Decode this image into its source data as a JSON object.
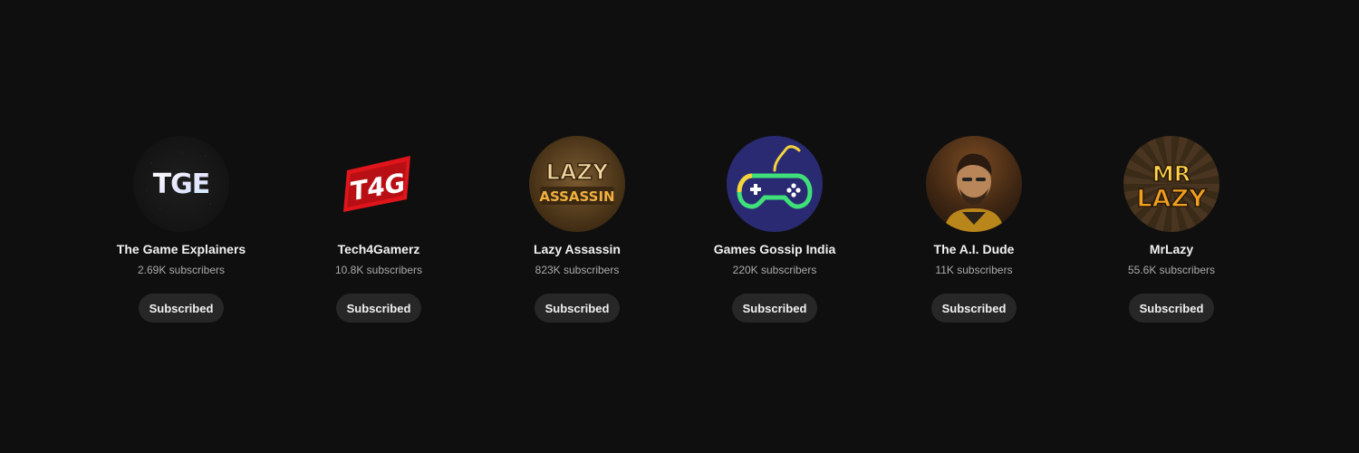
{
  "channels": [
    {
      "name": "The Game Explainers",
      "subscribers": "2.69K subscribers",
      "button": "Subscribed",
      "logo_text": "TGE",
      "icon": "tge-logo-icon"
    },
    {
      "name": "Tech4Gamerz",
      "subscribers": "10.8K subscribers",
      "button": "Subscribed",
      "logo_text": "T4G",
      "icon": "t4g-logo-icon"
    },
    {
      "name": "Lazy Assassin",
      "subscribers": "823K subscribers",
      "button": "Subscribed",
      "logo_text_top": "LAZY",
      "logo_text_bottom": "ASSASSIN",
      "icon": "lazy-assassin-logo-icon"
    },
    {
      "name": "Games Gossip India",
      "subscribers": "220K subscribers",
      "button": "Subscribed",
      "icon": "gamepad-icon"
    },
    {
      "name": "The A.I. Dude",
      "subscribers": "11K subscribers",
      "button": "Subscribed",
      "icon": "person-photo-icon"
    },
    {
      "name": "MrLazy",
      "subscribers": "55.6K subscribers",
      "button": "Subscribed",
      "logo_text_top": "MR",
      "logo_text_bottom": "LAZY",
      "icon": "mrlazy-logo-icon"
    }
  ],
  "colors": {
    "background": "#0f0f0f",
    "button_bg": "#272727",
    "name_text": "#f1f1f1",
    "subs_text": "#aaaaaa",
    "gamepad_bg": "#2a2a72",
    "gamepad_green": "#3fe07a",
    "gamepad_yellow": "#f5d33a",
    "t4g_red": "#e0151b",
    "lazy_orange": "#e8a030"
  }
}
